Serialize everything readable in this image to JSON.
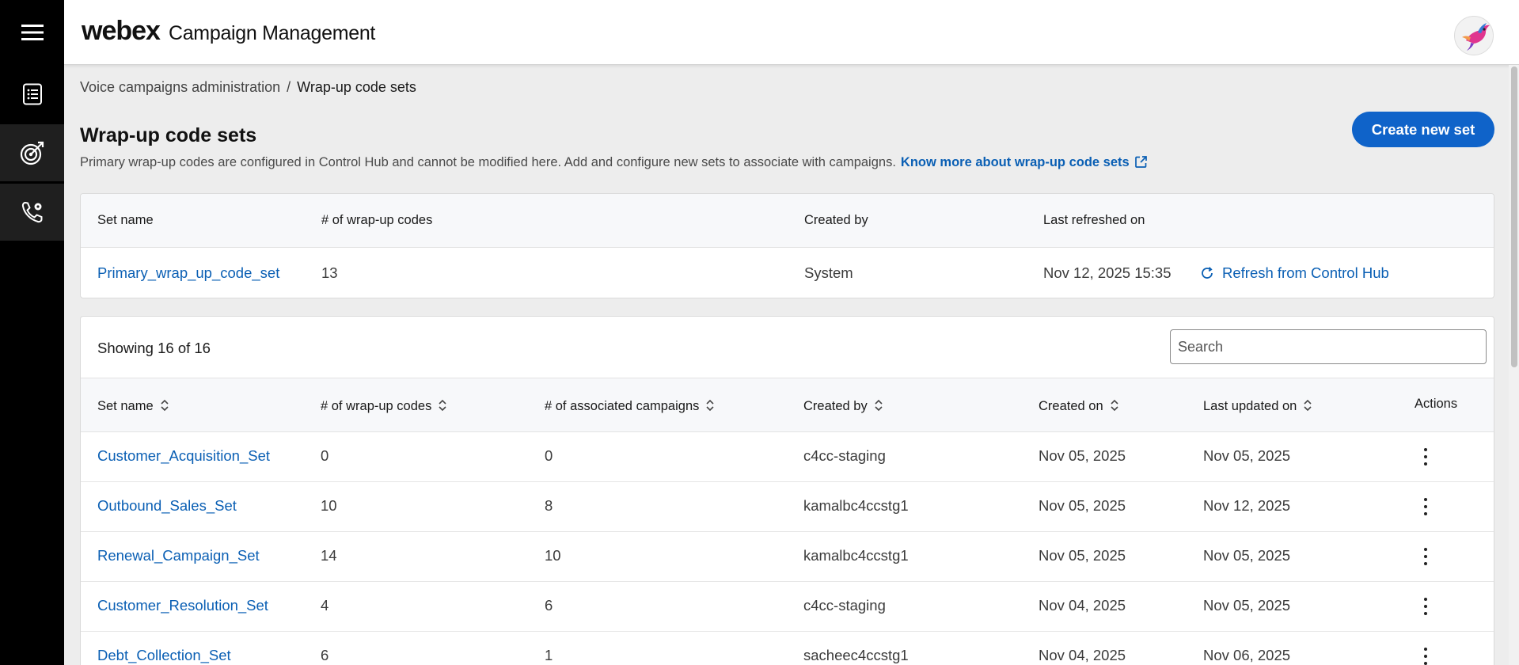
{
  "app": {
    "brand": "webex",
    "product": "Campaign Management"
  },
  "sidebar": {
    "items": [
      {
        "icon": "hamburger-menu-icon"
      },
      {
        "icon": "list-document-icon"
      },
      {
        "icon": "target-icon",
        "active": true
      },
      {
        "icon": "phone-settings-icon",
        "active": true
      }
    ]
  },
  "breadcrumb": {
    "parent": "Voice campaigns administration",
    "separator": "/",
    "current": "Wrap-up code sets"
  },
  "page": {
    "title": "Wrap-up code sets",
    "description": "Primary wrap-up codes are configured in Control Hub and cannot be modified here. Add and configure new sets to associate with campaigns.",
    "link": "Know more about wrap-up code sets",
    "create_button": "Create new set"
  },
  "primary_table": {
    "headers": {
      "set_name": "Set name",
      "codes": "# of wrap-up codes",
      "created_by": "Created by",
      "last_refreshed": "Last refreshed on"
    },
    "row": {
      "set_name": "Primary_wrap_up_code_set",
      "codes": "13",
      "created_by": "System",
      "last_refreshed": "Nov 12, 2025 15:35",
      "refresh_label": "Refresh from Control Hub"
    }
  },
  "sets_table": {
    "showing": "Showing 16 of 16",
    "search_placeholder": "Search",
    "headers": {
      "set_name": "Set name",
      "codes": "# of wrap-up codes",
      "campaigns": "# of associated campaigns",
      "created_by": "Created by",
      "created_on": "Created on",
      "updated_on": "Last updated on",
      "actions": "Actions"
    },
    "rows": [
      {
        "set_name": "Customer_Acquisition_Set",
        "codes": "0",
        "campaigns": "0",
        "created_by": "c4cc-staging",
        "created_on": "Nov 05, 2025",
        "updated_on": "Nov 05, 2025"
      },
      {
        "set_name": "Outbound_Sales_Set",
        "codes": "10",
        "campaigns": "8",
        "created_by": "kamalbc4ccstg1",
        "created_on": "Nov 05, 2025",
        "updated_on": "Nov 12, 2025"
      },
      {
        "set_name": "Renewal_Campaign_Set",
        "codes": "14",
        "campaigns": "10",
        "created_by": "kamalbc4ccstg1",
        "created_on": "Nov 05, 2025",
        "updated_on": "Nov 05, 2025"
      },
      {
        "set_name": "Customer_Resolution_Set",
        "codes": "4",
        "campaigns": "6",
        "created_by": "c4cc-staging",
        "created_on": "Nov 04, 2025",
        "updated_on": "Nov 05, 2025"
      },
      {
        "set_name": "Debt_Collection_Set",
        "codes": "6",
        "campaigns": "1",
        "created_by": "sacheec4ccstg1",
        "created_on": "Nov 04, 2025",
        "updated_on": "Nov 06, 2025"
      }
    ]
  },
  "colors": {
    "accent": "#0f63c9",
    "link": "#0a5fb4",
    "sidebar": "#000000",
    "background": "#ededed"
  }
}
